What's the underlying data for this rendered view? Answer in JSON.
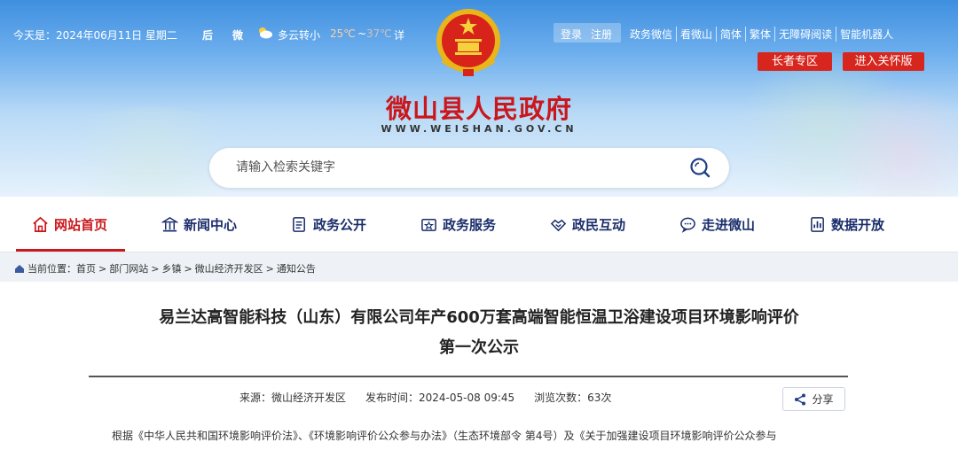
{
  "top": {
    "date": "今天是：2024年06月11日 星期二",
    "location_a": "后",
    "location_b": "微",
    "weather": "多云转小",
    "temp_high": "25℃",
    "temp_sep": "~",
    "temp_low": "37℃",
    "detail": "详",
    "login": "登录",
    "register": "注册",
    "links": [
      "政务微信",
      "看微山",
      "简体",
      "繁体",
      "无障碍阅读",
      "智能机器人"
    ],
    "elder": "长者专区",
    "care": "进入关怀版"
  },
  "site": {
    "title": "微山县人民政府",
    "url": "WWW.WEISHAN.GOV.CN"
  },
  "search": {
    "placeholder": "请输入检索关键字"
  },
  "nav": [
    {
      "label": "网站首页",
      "icon": "home-icon"
    },
    {
      "label": "新闻中心",
      "icon": "building-icon"
    },
    {
      "label": "政务公开",
      "icon": "document-icon"
    },
    {
      "label": "政务服务",
      "icon": "service-icon"
    },
    {
      "label": "政民互动",
      "icon": "handshake-icon"
    },
    {
      "label": "走进微山",
      "icon": "chat-icon"
    },
    {
      "label": "数据开放",
      "icon": "data-icon"
    }
  ],
  "breadcrumb": {
    "prefix": "当前位置：",
    "items": [
      "首页",
      "部门网站",
      "乡镇",
      "微山经济开发区",
      "通知公告"
    ],
    "separator": ">"
  },
  "article": {
    "title_line1": "易兰达高智能科技（山东）有限公司年产600万套高端智能恒温卫浴建设项目环境影响评价",
    "title_line2": "第一次公示",
    "source": "来源：微山经济开发区",
    "published": "发布时间：2024-05-08 09:45",
    "views": "浏览次数：63次",
    "share": "分享",
    "body_first_line": "根据《中华人民共和国环境影响评价法》、《环境影响评价公众参与办法》（生态环境部令 第4号）及《关于加强建设项目环境影响评价公众参与"
  },
  "colors": {
    "accent_red": "#c9171c",
    "nav_blue": "#1a2d6b",
    "sky_top": "#3f8fe0"
  }
}
